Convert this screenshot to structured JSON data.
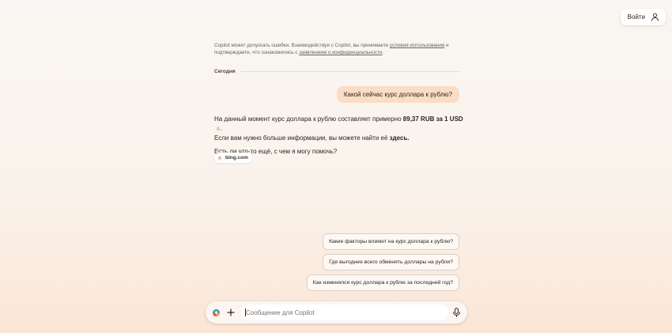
{
  "header": {
    "login_label": "Войти",
    "login_icon": "user-icon"
  },
  "disclaimer": {
    "prefix": "Copilot может допускать ошибки. Взаимодействуя с Copilot, вы принимаете ",
    "terms_link": "условия использования",
    "middle": " и подтверждаете, что ознакомились с ",
    "privacy_link": "заявлением о конфиденциальности",
    "suffix": "."
  },
  "conversation": {
    "date_divider": "Сегодня",
    "user_message": "Какой сейчас курс доллара к рублю?",
    "answer": {
      "line1_prefix": "На данный момент курс доллара к рублю составляет примерно ",
      "line1_bold": "89,37 RUB за 1 USD",
      "citation_number": "1",
      "line1_suffix": ".",
      "line2_prefix": "Если вам нужно больше информации, вы можете найти её ",
      "line2_link": "здесь",
      "line2_suffix": ".",
      "followup": "Есть ли что-то ещё, с чем я могу помочь?"
    },
    "sources": [
      {
        "number": "1",
        "label": "bing.com"
      }
    ]
  },
  "suggestions": [
    "Какие факторы влияют на курс доллара к рублю?",
    "Где выгоднее всего обменять доллары на рубли?",
    "Как изменялся курс доллара к рублю за последний год?"
  ],
  "composer": {
    "placeholder": "Сообщение для Copilot",
    "value": "",
    "left_icons": [
      "copilot-logo-icon",
      "plus-icon"
    ],
    "right_icon": "microphone-icon"
  },
  "colors": {
    "user_bubble": "#fbdcc4",
    "accent": "#c0652a",
    "text": "#2b2520"
  }
}
